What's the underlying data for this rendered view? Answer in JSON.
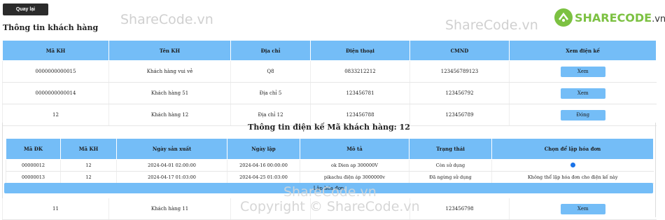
{
  "back_button": "Quay lại",
  "page_title": "Thông tin khách hàng",
  "watermarks": [
    "ShareCode.vn",
    "ShareCode.vn",
    "ShareCode.vn",
    "Copyright © ShareCode.vn"
  ],
  "logo": {
    "main": "SHARECODE",
    "suffix": ".vn"
  },
  "customers": {
    "headers": [
      "Mã KH",
      "Tên KH",
      "Địa chỉ",
      "Điện thoại",
      "CMND",
      "Xem điện kế"
    ],
    "rows": [
      {
        "ma": "0000000000015",
        "ten": "Khách hàng vui vẻ",
        "dia_chi": "Q8",
        "dien_thoai": "0833212212",
        "cmnd": "123456789123",
        "action": "Xem"
      },
      {
        "ma": "0000000000014",
        "ten": "Khách hàng 51",
        "dia_chi": "Địa chỉ 5",
        "dien_thoai": "123456781",
        "cmnd": "123456792",
        "action": "Xem"
      },
      {
        "ma": "12",
        "ten": "Khách hàng 12",
        "dia_chi": "Địa chỉ 12",
        "dien_thoai": "123456788",
        "cmnd": "123456789",
        "action": "Đóng"
      }
    ]
  },
  "meter_section": {
    "title": "Thông tin điện kế Mã khách hàng: 12",
    "headers": [
      "Mã ĐK",
      "Mã KH",
      "Ngày sản xuất",
      "Ngày lập",
      "Mô tả",
      "Trạng thái",
      "Chọn để lập hóa đơn"
    ],
    "rows": [
      {
        "ma_dk": "00000012",
        "ma_kh": "12",
        "ngay_sx": "2024-04-01 02:00:00",
        "ngay_lap": "2024-04-16 00:00:00",
        "mo_ta": "ok Dien ap 300000V",
        "trang_thai": "Còn sử dụng",
        "chon": "radio"
      },
      {
        "ma_dk": "00000013",
        "ma_kh": "12",
        "ngay_sx": "2024-04-17 01:03:00",
        "ngay_lap": "2024-04-25 01:03:00",
        "mo_ta": "pikachu điện áp 3000000v",
        "trang_thai": "Đã ngừng sử dụng",
        "chon": "Không thể lập hóa đơn cho điện kế này"
      }
    ],
    "bar_button": "Lập hóa đơn"
  },
  "bottom_row": {
    "ma": "11",
    "ten": "Khách hàng 11",
    "dia_chi": "",
    "dien_thoai": "",
    "cmnd": "123456798",
    "action": "Xem"
  }
}
